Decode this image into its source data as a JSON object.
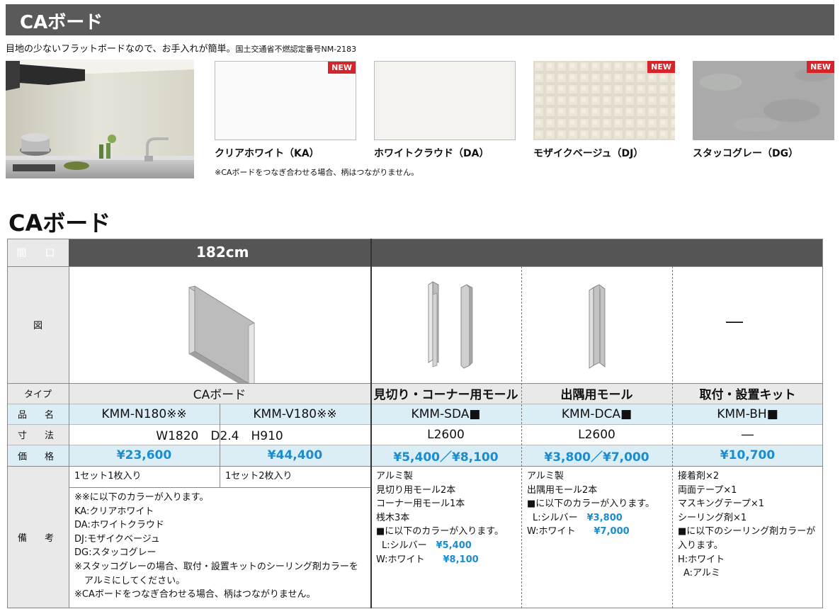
{
  "header": {
    "title": "CAボード"
  },
  "description": {
    "main": "目地の少ないフラットボードなので、お手入れが簡単。",
    "cert": "国土交通省不燃認定番号NM-2183"
  },
  "swatches": [
    {
      "label": "クリアホワイト（KA）",
      "badge": "NEW",
      "color": "#fbfbfb"
    },
    {
      "label": "ホワイトクラウド（DA）",
      "badge": "",
      "color": "#f4f3f0"
    },
    {
      "label": "モザイクベージュ（DJ）",
      "badge": "NEW",
      "color": "#ece6d8"
    },
    {
      "label": "スタッコグレー（DG）",
      "badge": "NEW",
      "color": "#a9aaa9"
    }
  ],
  "swatch_note": "※CAボードをつなぎ合わせる場合、柄はつながりません。",
  "section_title": "CAボード",
  "table": {
    "row_labels": {
      "width": "間　口",
      "figure": "図",
      "type": "タイプ",
      "hinmei": "品　名",
      "size": "寸　法",
      "price": "価　格",
      "notes": "備　考"
    },
    "width_value": "182cm",
    "types": {
      "board": "CAボード",
      "sda": "見切り・コーナー用モール",
      "dca": "出隅用モール",
      "bh": "取付・設置キット"
    },
    "hinmei": {
      "n180": "KMM-N180※※",
      "v180": "KMM-V180※※",
      "sda": "KMM-SDA■",
      "dca": "KMM-DCA■",
      "bh": "KMM-BH■"
    },
    "sizes": {
      "board": "W1820　D2.4　H910",
      "sda": "L2600",
      "dca": "L2600",
      "bh": "―"
    },
    "prices": {
      "n180": "¥23,600",
      "v180": "¥44,400",
      "sda": "¥5,400／¥8,100",
      "dca": "¥3,800／¥7,000",
      "bh": "¥10,700"
    },
    "bh_figure": "―",
    "notes": {
      "n180_set": "1セット1枚入り",
      "v180_set": "1セット2枚入り",
      "board": {
        "l1": "※※に以下のカラーが入ります。",
        "l2": "KA:クリアホワイト",
        "l3": "DA:ホワイトクラウド",
        "l4": "DJ:モザイクベージュ",
        "l5": "DG:スタッコグレー",
        "l6": "※スタッコグレーの場合、取付・設置キットのシーリング剤カラーを",
        "l7": "アルミにしてください。",
        "l8": "※CAボードをつなぎ合わせる場合、柄はつながりません。"
      },
      "sda": {
        "l1": "アルミ製",
        "l2": "見切り用モール2本",
        "l3": "コーナー用モール1本",
        "l4": "桟木3本",
        "l5": "■に以下のカラーが入ります。",
        "l6a": "L:シルバー",
        "l6b": "¥5,400",
        "l7a": "W:ホワイト",
        "l7b": "¥8,100"
      },
      "dca": {
        "l1": "アルミ製",
        "l2": "出隅用モール2本",
        "l3": "■に以下のカラーが入ります。",
        "l4a": "L:シルバー",
        "l4b": "¥3,800",
        "l5a": "W:ホワイト",
        "l5b": "¥7,000"
      },
      "bh": {
        "l1": "接着剤×2",
        "l2": "両面テープ×1",
        "l3": "マスキングテープ×1",
        "l4": "シーリング剤×1",
        "l5": "■に以下のシーリング剤カラーが",
        "l6": "入ります。",
        "l7": "H:ホワイト",
        "l8": "A:アルミ"
      }
    }
  }
}
